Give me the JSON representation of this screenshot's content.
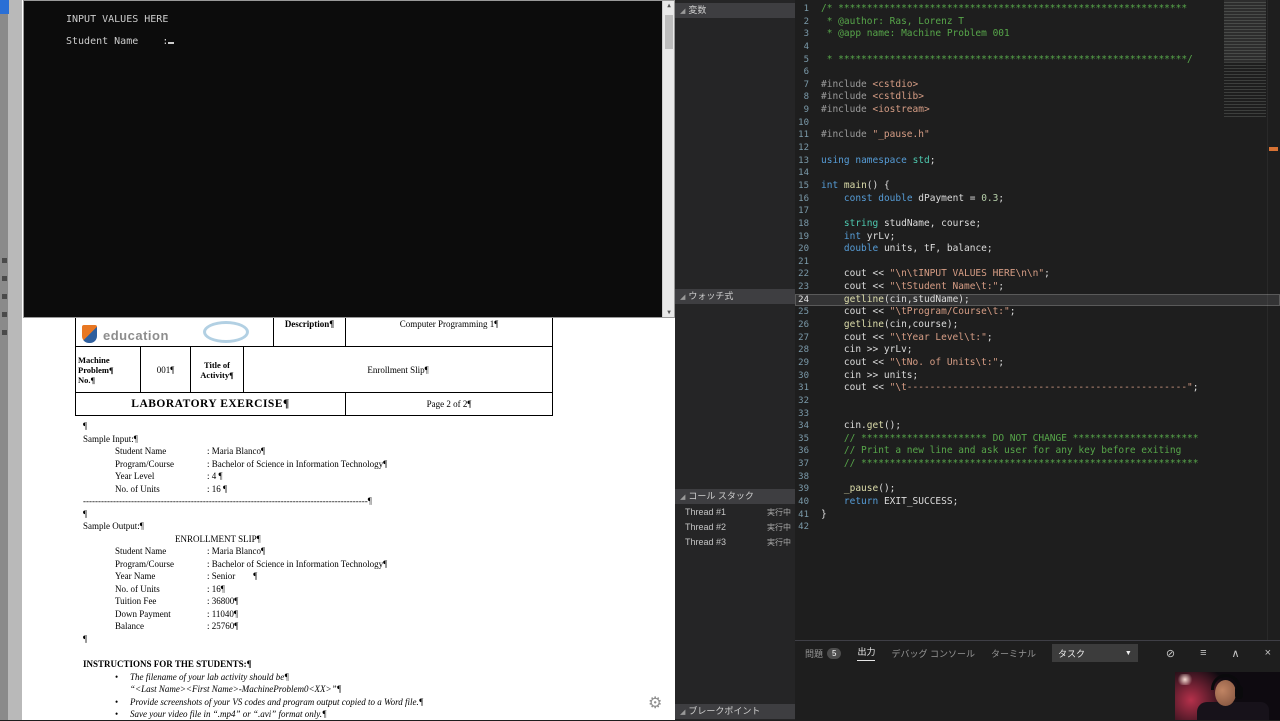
{
  "colors": {
    "editor_bg": "#1e1e1e",
    "panel_bg": "#252526",
    "comment_green": "#57a64a",
    "keyword_blue": "#569cd6",
    "string_orange": "#d69d85",
    "scroll_mark_orange": "#d77234"
  },
  "console": {
    "title_line": "INPUT VALUES HERE",
    "prompt": "Student Name    :",
    "up_arrow": "▲",
    "down_arrow": "▼"
  },
  "document": {
    "logo_text": "education",
    "table": {
      "description_label": "Description¶",
      "description_value": "Computer Programming 1¶",
      "mp_label_1": "Machine Problem¶",
      "mp_label_2": "No.¶",
      "mp_value": "001¶",
      "title_label": "Title of Activity¶",
      "title_value": "Enrollment Slip¶",
      "lab_exercise": "LABORATORY EXERCISE¶",
      "page": "Page 2 of 2¶"
    },
    "para_mark": "¶",
    "sample_input": {
      "heading": "Sample Input:¶",
      "rows": [
        [
          "Student Name",
          ": Maria Blanco¶"
        ],
        [
          "Program/Course",
          ": Bachelor of Science in Information Technology¶"
        ],
        [
          "Year Level",
          ": 4 ¶"
        ],
        [
          "No. of Units",
          ": 16 ¶"
        ]
      ],
      "divider": "-----------------------------------------------------------------------------------------------¶"
    },
    "sample_output": {
      "heading": "Sample Output:¶",
      "title": "ENROLLMENT SLIP¶",
      "rows": [
        [
          "Student Name",
          ": Maria Blanco¶"
        ],
        [
          "Program/Course",
          ": Bachelor of Science in Information Technology¶"
        ],
        [
          "Year Name",
          ": Senior        ¶"
        ],
        [
          "No. of Units",
          ": 16¶"
        ],
        [
          "Tuition Fee",
          ": 36800¶"
        ],
        [
          "Down Payment",
          ": 11040¶"
        ],
        [
          "Balance",
          ": 25760¶"
        ]
      ]
    },
    "instructions": {
      "heading": "INSTRUCTIONS FOR THE STUDENTS:¶",
      "bullets": [
        {
          "b": true,
          "text": "The filename of your lab activity should be¶"
        },
        {
          "b": false,
          "text": "“<Last Name><First Name>-MachineProblem0<XX>”¶"
        },
        {
          "b": true,
          "text": "Provide screenshots of your VS codes and program output copied to a Word file.¶"
        },
        {
          "b": true,
          "text": "Save your video file in “.mp4” or “.avi” format only.¶"
        }
      ]
    }
  },
  "debug_panels": {
    "variables_title": "変数",
    "watch_title": "ウォッチ式",
    "callstack_title": "コール スタック",
    "breakpoints_title": "ブレークポイント",
    "collapse_glyph": "◢",
    "threads": [
      {
        "name": "Thread #1",
        "status": "実行中"
      },
      {
        "name": "Thread #2",
        "status": "実行中"
      },
      {
        "name": "Thread #3",
        "status": "実行中"
      }
    ]
  },
  "editor": {
    "lines": [
      {
        "n": 1,
        "t": [
          [
            "c",
            "/* *************************************************************"
          ]
        ]
      },
      {
        "n": 2,
        "t": [
          [
            "c",
            " * @author: Ras, Lorenz T"
          ]
        ]
      },
      {
        "n": 3,
        "t": [
          [
            "c",
            " * @app name: Machine Problem 001"
          ]
        ]
      },
      {
        "n": 4,
        "t": []
      },
      {
        "n": 5,
        "t": [
          [
            "c",
            " * *************************************************************/"
          ]
        ]
      },
      {
        "n": 6,
        "t": []
      },
      {
        "n": 7,
        "t": [
          [
            "d",
            "#include "
          ],
          [
            "h",
            "<cstdio>"
          ]
        ]
      },
      {
        "n": 8,
        "t": [
          [
            "d",
            "#include "
          ],
          [
            "h",
            "<cstdlib>"
          ]
        ]
      },
      {
        "n": 9,
        "t": [
          [
            "d",
            "#include "
          ],
          [
            "h",
            "<iostream>"
          ]
        ]
      },
      {
        "n": 10,
        "t": []
      },
      {
        "n": 11,
        "t": [
          [
            "d",
            "#include "
          ],
          [
            "h",
            "\"_pause.h\""
          ]
        ]
      },
      {
        "n": 12,
        "t": []
      },
      {
        "n": 13,
        "t": [
          [
            "k",
            "using"
          ],
          [
            "p",
            " "
          ],
          [
            "k",
            "namespace"
          ],
          [
            "p",
            " "
          ],
          [
            "t",
            "std"
          ],
          [
            "p",
            ";"
          ]
        ]
      },
      {
        "n": 14,
        "t": []
      },
      {
        "n": 15,
        "t": [
          [
            "k",
            "int"
          ],
          [
            "p",
            " "
          ],
          [
            "f",
            "main"
          ],
          [
            "p",
            "() {"
          ]
        ]
      },
      {
        "n": 16,
        "t": [
          [
            "p",
            "    "
          ],
          [
            "k",
            "const"
          ],
          [
            "p",
            " "
          ],
          [
            "k",
            "double"
          ],
          [
            "p",
            " dPayment = "
          ],
          [
            "n",
            "0.3"
          ],
          [
            "p",
            ";"
          ]
        ]
      },
      {
        "n": 17,
        "t": []
      },
      {
        "n": 18,
        "t": [
          [
            "p",
            "    "
          ],
          [
            "t",
            "string"
          ],
          [
            "p",
            " studName, course;"
          ]
        ]
      },
      {
        "n": 19,
        "t": [
          [
            "p",
            "    "
          ],
          [
            "k",
            "int"
          ],
          [
            "p",
            " yrLv;"
          ]
        ]
      },
      {
        "n": 20,
        "t": [
          [
            "p",
            "    "
          ],
          [
            "k",
            "double"
          ],
          [
            "p",
            " units, tF, balance;"
          ]
        ]
      },
      {
        "n": 21,
        "t": []
      },
      {
        "n": 22,
        "t": [
          [
            "p",
            "    cout << "
          ],
          [
            "s",
            "\"\\n\\tINPUT VALUES HERE\\n\\n\""
          ],
          [
            "p",
            ";"
          ]
        ]
      },
      {
        "n": 23,
        "t": [
          [
            "p",
            "    cout << "
          ],
          [
            "s",
            "\"\\tStudent Name\\t:\""
          ],
          [
            "p",
            ";"
          ]
        ]
      },
      {
        "n": 24,
        "cur": true,
        "t": [
          [
            "p",
            "    "
          ],
          [
            "f",
            "getline"
          ],
          [
            "p",
            "(cin,studName);"
          ]
        ]
      },
      {
        "n": 25,
        "t": [
          [
            "p",
            "    cout << "
          ],
          [
            "s",
            "\"\\tProgram/Course\\t:\""
          ],
          [
            "p",
            ";"
          ]
        ]
      },
      {
        "n": 26,
        "t": [
          [
            "p",
            "    "
          ],
          [
            "f",
            "getline"
          ],
          [
            "p",
            "(cin,course);"
          ]
        ]
      },
      {
        "n": 27,
        "t": [
          [
            "p",
            "    cout << "
          ],
          [
            "s",
            "\"\\tYear Level\\t:\""
          ],
          [
            "p",
            ";"
          ]
        ]
      },
      {
        "n": 28,
        "t": [
          [
            "p",
            "    cin >> yrLv;"
          ]
        ]
      },
      {
        "n": 29,
        "t": [
          [
            "p",
            "    cout << "
          ],
          [
            "s",
            "\"\\tNo. of Units\\t:\""
          ],
          [
            "p",
            ";"
          ]
        ]
      },
      {
        "n": 30,
        "t": [
          [
            "p",
            "    cin >> units;"
          ]
        ]
      },
      {
        "n": 31,
        "t": [
          [
            "p",
            "    cout << "
          ],
          [
            "s",
            "\"\\t-------------------------------------------------\""
          ],
          [
            "p",
            ";"
          ]
        ]
      },
      {
        "n": 32,
        "t": []
      },
      {
        "n": 33,
        "t": []
      },
      {
        "n": 34,
        "t": [
          [
            "p",
            "    cin."
          ],
          [
            "f",
            "get"
          ],
          [
            "p",
            "();"
          ]
        ]
      },
      {
        "n": 35,
        "t": [
          [
            "p",
            "    "
          ],
          [
            "c",
            "// ********************** DO NOT CHANGE **********************"
          ]
        ]
      },
      {
        "n": 36,
        "t": [
          [
            "p",
            "    "
          ],
          [
            "c",
            "// Print a new line and ask user for any key before exiting"
          ]
        ]
      },
      {
        "n": 37,
        "t": [
          [
            "p",
            "    "
          ],
          [
            "c",
            "// ***********************************************************"
          ]
        ]
      },
      {
        "n": 38,
        "t": []
      },
      {
        "n": 39,
        "t": [
          [
            "p",
            "    "
          ],
          [
            "f",
            "_pause"
          ],
          [
            "p",
            "();"
          ]
        ]
      },
      {
        "n": 40,
        "t": [
          [
            "p",
            "    "
          ],
          [
            "k",
            "return"
          ],
          [
            "p",
            " EXIT_SUCCESS;"
          ]
        ]
      },
      {
        "n": 41,
        "t": [
          [
            "p",
            "}"
          ]
        ]
      },
      {
        "n": 42,
        "t": []
      }
    ]
  },
  "bottom_panel": {
    "problems_tab": "問題",
    "problems_badge": "5",
    "output_tab": "出力",
    "debug_console_tab": "デバッグ コンソール",
    "terminal_tab": "ターミナル",
    "task_dropdown": "タスク",
    "dropdown_arrow": "▼",
    "icon_clear": "⊘",
    "icon_list": "≡",
    "icon_chevron_up": "∧",
    "icon_close": "×"
  },
  "gear_glyph": "⚙"
}
